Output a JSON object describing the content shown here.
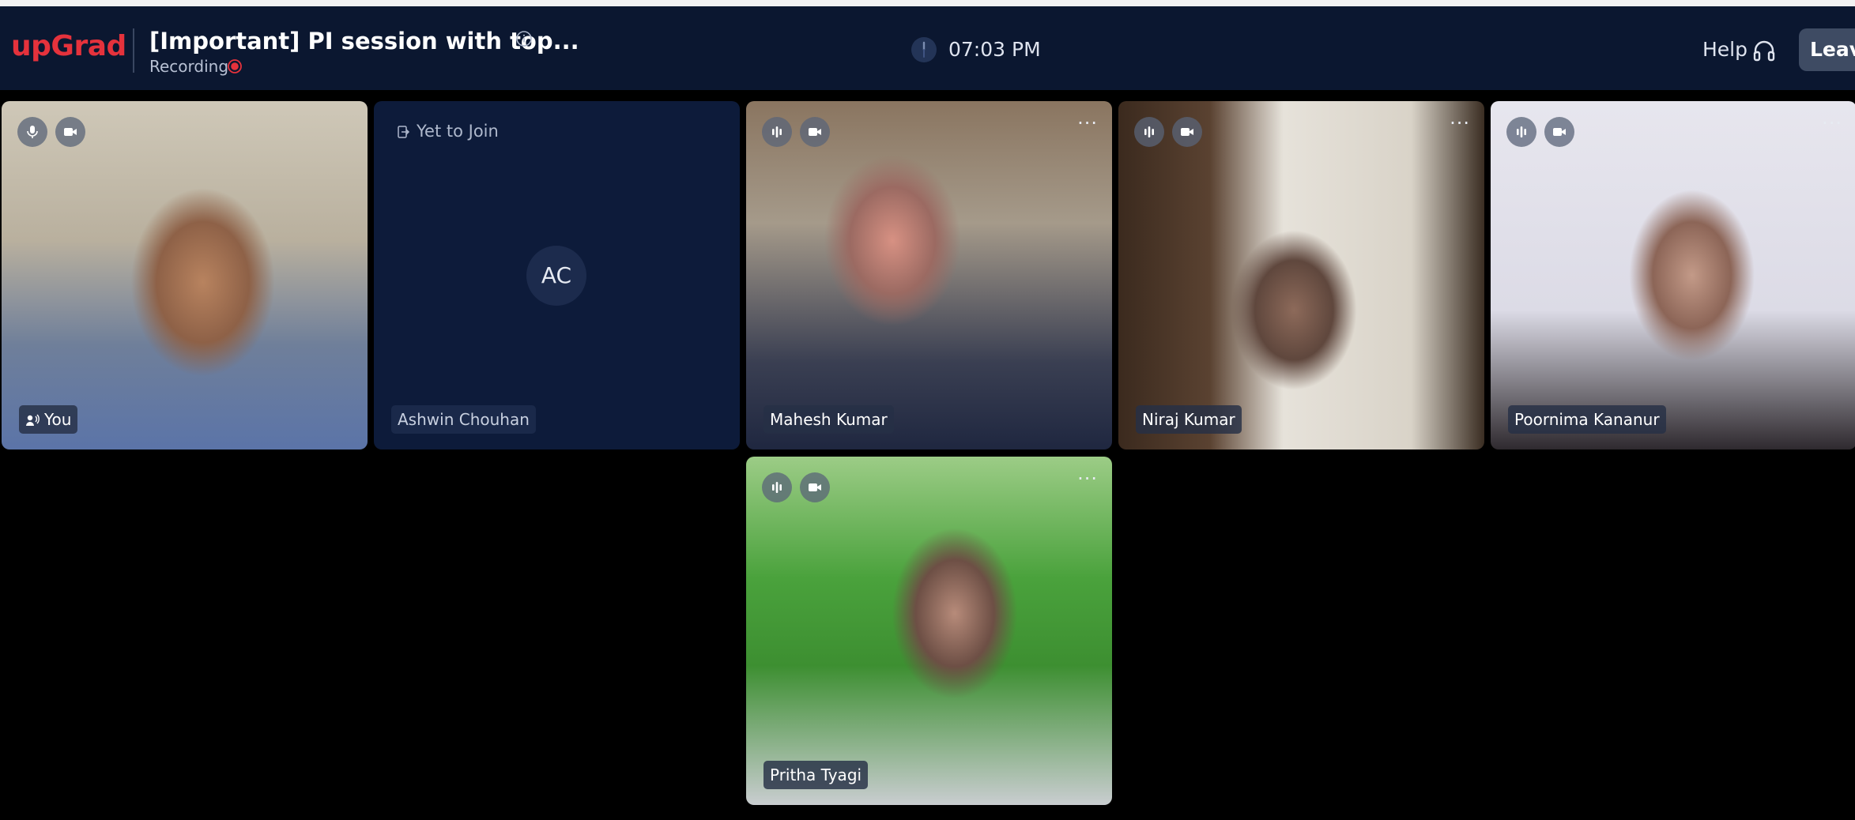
{
  "header": {
    "logo": "upGrad",
    "title": "[Important] PI session with top...",
    "recording_label": "Recording",
    "time": "07:03 PM",
    "help_label": "Help",
    "leave_label": "Leave"
  },
  "participants": [
    {
      "name": "You",
      "state": "video",
      "mic": "on",
      "speaking": true
    },
    {
      "name": "Ashwin Chouhan",
      "state": "yet-to-join",
      "status_label": "Yet to Join",
      "initials": "AC"
    },
    {
      "name": "Mahesh Kumar",
      "state": "video",
      "mic": "speaking"
    },
    {
      "name": "Niraj Kumar",
      "state": "video",
      "mic": "speaking"
    },
    {
      "name": "Poornima Kananur",
      "state": "video",
      "mic": "speaking"
    },
    {
      "name": "Pritha Tyagi",
      "state": "video",
      "mic": "speaking"
    }
  ],
  "colors": {
    "header_bg": "#0b1730",
    "brand_red": "#e5323c",
    "empty_tile_bg": "#0d1b3a",
    "recording_red": "#e5323c"
  },
  "icons": {
    "info": "info-icon",
    "record": "record-dot-icon",
    "clock": "clock-icon",
    "headset": "headset-icon",
    "mic": "mic-icon",
    "audio_level": "audio-level-icon",
    "camera": "camera-icon",
    "more": "more-icon",
    "join": "join-icon",
    "speaker": "speaker-icon"
  }
}
